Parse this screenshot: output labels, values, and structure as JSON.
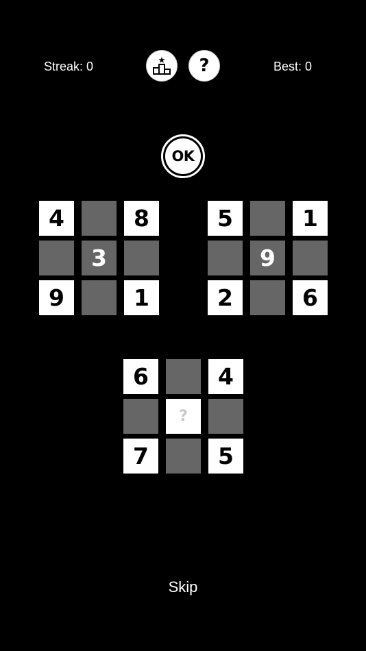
{
  "header": {
    "streak_text": "Streak: 0",
    "best_text": "Best: 0",
    "leaderboard_icon": "podium-star-icon",
    "help_label": "?"
  },
  "ok_button": {
    "label": "OK"
  },
  "puzzles": {
    "left": [
      [
        "4",
        "",
        "8"
      ],
      [
        "",
        "3",
        ""
      ],
      [
        "9",
        "",
        "1"
      ]
    ],
    "right": [
      [
        "5",
        "",
        "1"
      ],
      [
        "",
        "9",
        ""
      ],
      [
        "2",
        "",
        "6"
      ]
    ],
    "bottom": [
      [
        "6",
        "",
        "4"
      ],
      [
        "",
        "?",
        ""
      ],
      [
        "7",
        "",
        "5"
      ]
    ]
  },
  "skip_label": "Skip",
  "colors": {
    "background": "#000000",
    "tile_white": "#ffffff",
    "tile_gray": "#666666",
    "answer_placeholder": "#c8c8c8"
  }
}
